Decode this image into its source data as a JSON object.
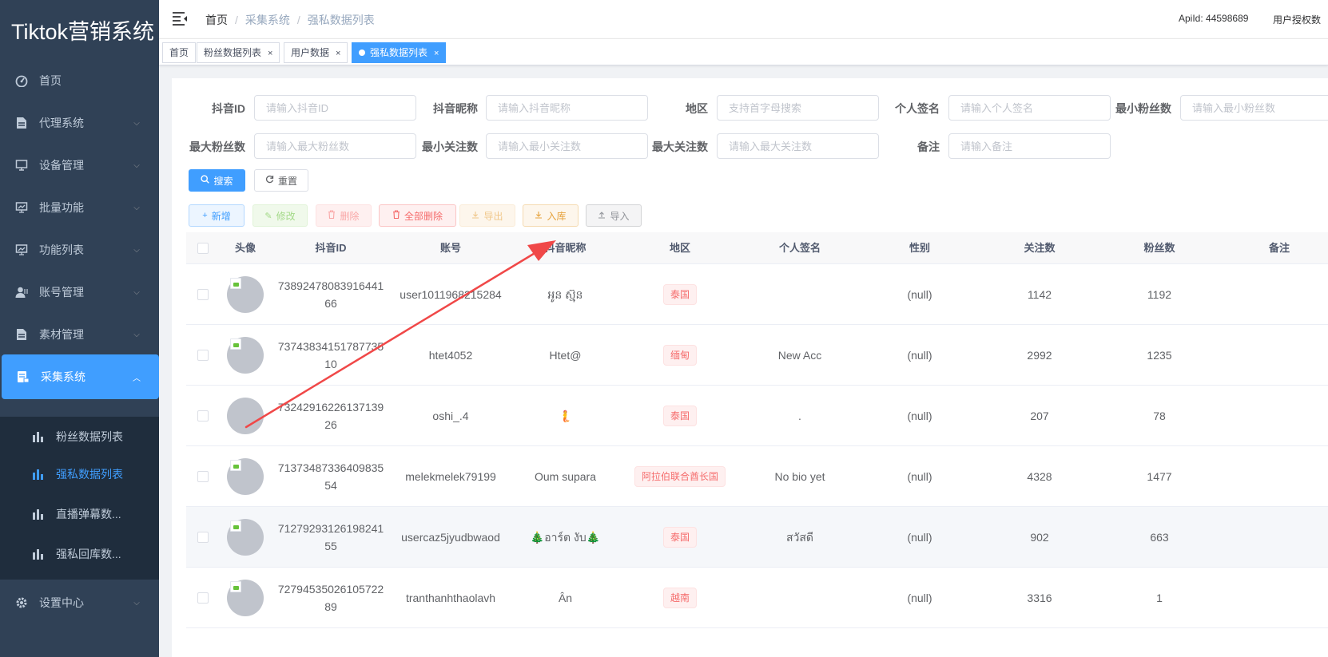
{
  "app": {
    "title": "Tiktok营销系统"
  },
  "sidebar": {
    "items": [
      {
        "label": "首页",
        "icon": "dashboard-icon",
        "arrow": ""
      },
      {
        "label": "代理系统",
        "icon": "document-icon",
        "arrow": "⌵"
      },
      {
        "label": "设备管理",
        "icon": "monitor-icon",
        "arrow": "⌵"
      },
      {
        "label": "批量功能",
        "icon": "monitor-chart-icon",
        "arrow": "⌵"
      },
      {
        "label": "功能列表",
        "icon": "monitor-chart-icon",
        "arrow": "⌵"
      },
      {
        "label": "账号管理",
        "icon": "user-icon",
        "arrow": "⌵"
      },
      {
        "label": "素材管理",
        "icon": "document-icon",
        "arrow": "⌵"
      },
      {
        "label": "采集系统",
        "icon": "server-icon",
        "arrow": "︿"
      },
      {
        "label": "设置中心",
        "icon": "gear-icon",
        "arrow": "⌵"
      }
    ],
    "subitems": [
      {
        "label": "粉丝数据列表"
      },
      {
        "label": "强私数据列表"
      },
      {
        "label": "直播弹幕数..."
      },
      {
        "label": "强私回库数..."
      }
    ]
  },
  "header": {
    "breadcrumb": [
      "首页",
      "采集系统",
      "强私数据列表"
    ],
    "apiid": "ApiId: 44598689",
    "license": "用户授权数"
  },
  "tags": [
    {
      "label": "首页",
      "close": ""
    },
    {
      "label": "粉丝数据列表",
      "close": "×"
    },
    {
      "label": "用户数据",
      "close": "×"
    },
    {
      "label": "强私数据列表",
      "close": "×"
    }
  ],
  "filters": {
    "douyin_id": {
      "label": "抖音ID",
      "placeholder": "请输入抖音ID"
    },
    "nickname": {
      "label": "抖音昵称",
      "placeholder": "请输入抖音昵称"
    },
    "region": {
      "label": "地区",
      "placeholder": "支持首字母搜索"
    },
    "signature": {
      "label": "个人签名",
      "placeholder": "请输入个人签名"
    },
    "min_fans": {
      "label": "最小粉丝数",
      "placeholder": "请输入最小粉丝数"
    },
    "max_fans": {
      "label": "最大粉丝数",
      "placeholder": "请输入最大粉丝数"
    },
    "min_follow": {
      "label": "最小关注数",
      "placeholder": "请输入最小关注数"
    },
    "max_follow": {
      "label": "最大关注数",
      "placeholder": "请输入最大关注数"
    },
    "remark": {
      "label": "备注",
      "placeholder": "请输入备注"
    }
  },
  "buttons": {
    "search": "搜索",
    "reset": "重置",
    "add": "新增",
    "edit": "修改",
    "delete": "删除",
    "delete_all": "全部删除",
    "export": "导出",
    "store": "入库",
    "import": "导入"
  },
  "table": {
    "columns": [
      "头像",
      "抖音ID",
      "账号",
      "抖音昵称",
      "地区",
      "个人签名",
      "性别",
      "关注数",
      "粉丝数",
      "备注"
    ],
    "rows": [
      {
        "id_line1": "73892478083916441",
        "id_line2": "66",
        "account": "user1011968215284",
        "nickname": "អូន ស្ម៊ុន",
        "region": "泰国",
        "signature": "",
        "gender": "(null)",
        "following": "1142",
        "fans": "1192",
        "remark": "",
        "avatar_broken": true
      },
      {
        "id_line1": "73743834151787735",
        "id_line2": "10",
        "account": "htet4052",
        "nickname": "Htet@",
        "region": "缅甸",
        "signature": "New Acc",
        "gender": "(null)",
        "following": "2992",
        "fans": "1235",
        "remark": "",
        "avatar_broken": true
      },
      {
        "id_line1": "73242916226137139",
        "id_line2": "26",
        "account": "oshi_.4",
        "nickname": "🧜",
        "region": "泰国",
        "signature": ".",
        "gender": "(null)",
        "following": "207",
        "fans": "78",
        "remark": "",
        "avatar_broken": false
      },
      {
        "id_line1": "71373487336409835",
        "id_line2": "54",
        "account": "melekmelek79199",
        "nickname": "Oum supara",
        "region": "阿拉伯联合酋长国",
        "signature": "No bio yet",
        "gender": "(null)",
        "following": "4328",
        "fans": "1477",
        "remark": "",
        "avatar_broken": true
      },
      {
        "id_line1": "71279293126198241",
        "id_line2": "55",
        "account": "usercaz5jyudbwaod",
        "nickname": "🎄อาร์ต งับ🎄",
        "region": "泰国",
        "signature": "สวัสดี",
        "gender": "(null)",
        "following": "902",
        "fans": "663",
        "remark": "",
        "avatar_broken": true
      },
      {
        "id_line1": "72794535026105722",
        "id_line2": "89",
        "account": "tranthanhthaolavh",
        "nickname": "Ân",
        "region": "越南",
        "signature": "",
        "gender": "(null)",
        "following": "3316",
        "fans": "1",
        "remark": "",
        "avatar_broken": true
      }
    ]
  },
  "colors": {
    "sidebar_bg": "#304156",
    "submenu_bg": "#1f2d3d",
    "primary": "#409eff",
    "annotation_arrow": "#f04848"
  }
}
